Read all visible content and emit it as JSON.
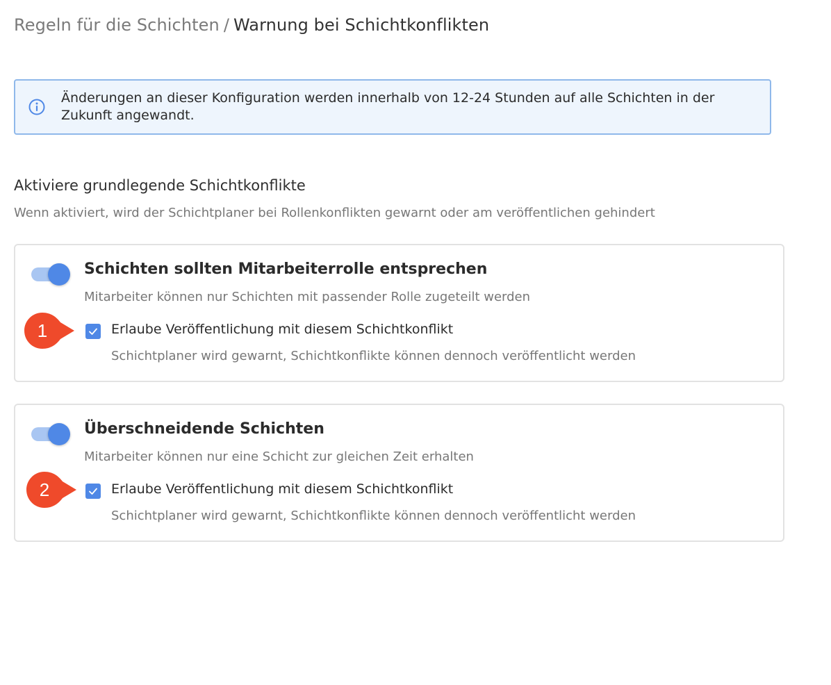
{
  "breadcrumb": {
    "parent": "Regeln für die Schichten",
    "separator": "/",
    "current": "Warnung bei Schichtkonflikten"
  },
  "info": {
    "icon": "info-icon",
    "text": "Änderungen an dieser Konfiguration werden innerhalb von 12-24 Stunden auf alle Schichten in der Zukunft angewandt."
  },
  "section": {
    "title": "Aktiviere grundlegende Schichtkonflikte",
    "description": "Wenn aktiviert, wird der Schichtplaner bei Rollenkonflikten gewarnt oder am veröffentlichen gehindert"
  },
  "rules": [
    {
      "enabled": true,
      "title": "Schichten sollten Mitarbeiterrolle entsprechen",
      "description": "Mitarbeiter können nur Schichten mit passender Rolle zugeteilt werden",
      "checkbox_checked": true,
      "checkbox_label": "Erlaube Veröffentlichung mit diesem Schichtkonflikt",
      "checkbox_description": "Schichtplaner wird gewarnt, Schichtkonflikte können dennoch veröffentlicht werden",
      "callout": "1"
    },
    {
      "enabled": true,
      "title": "Überschneidende Schichten",
      "description": "Mitarbeiter können nur eine Schicht zur gleichen Zeit erhalten",
      "checkbox_checked": true,
      "checkbox_label": "Erlaube Veröffentlichung mit diesem Schichtkonflikt",
      "checkbox_description": "Schichtplaner wird gewarnt, Schichtkonflikte können dennoch veröffentlicht werden",
      "callout": "2"
    }
  ],
  "colors": {
    "accent": "#4f88e6",
    "callout": "#ef4a2b",
    "info_background": "#eef5fd",
    "info_border": "#8fb8ea"
  }
}
